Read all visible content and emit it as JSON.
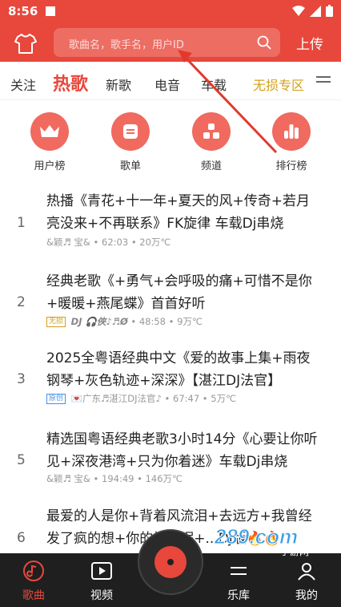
{
  "status_bar": {
    "time": "8:56"
  },
  "header": {
    "search_placeholder": "歌曲名，歌手名，用户ID",
    "upload_label": "上传"
  },
  "tabs": [
    {
      "label": "关注"
    },
    {
      "label": "热歌"
    },
    {
      "label": "新歌"
    },
    {
      "label": "电音"
    },
    {
      "label": "车载"
    },
    {
      "label": "无损专区"
    }
  ],
  "categories": [
    {
      "label": "用户榜",
      "icon": "crown-icon"
    },
    {
      "label": "歌单",
      "icon": "playlist-icon"
    },
    {
      "label": "频道",
      "icon": "channel-icon"
    },
    {
      "label": "排行榜",
      "icon": "ranking-icon"
    }
  ],
  "songs": [
    {
      "rank": "1",
      "title": "热播《青花+十一年+夏天的风+传奇+若月亮没来+不再联系》FK旋律 车载Dj串烧",
      "uploader": "&颖♬ 宝&",
      "duration": "62:03",
      "plays": "20万℃",
      "tag": ""
    },
    {
      "rank": "2",
      "title": "经典老歌《+勇气+会呼吸的痛+可惜不是你+暖暖+燕尾蝶》首首好听",
      "uploader": "DJ 🎧俠♪♬Ø",
      "duration": "48:58",
      "plays": "9万℃",
      "tag": "无损"
    },
    {
      "rank": "3",
      "title": "2025全粤语经典中文《爱的故事上集+雨夜钢琴+灰色轨迹+深深》【湛江DJ法官】",
      "uploader": "💌广东♬湛江DJ法官♪",
      "duration": "67:47",
      "plays": "5万℃",
      "tag": "原创"
    },
    {
      "rank": "5",
      "title": "精选国粤语经典老歌3小时14分《心要让你听见+深夜港湾+只为你着迷》车载Dj串烧",
      "uploader": "&颖♬ 宝&",
      "duration": "194:49",
      "plays": "146万℃",
      "tag": ""
    },
    {
      "rank": "6",
      "title": "最爱的人是你+背着风流泪+去远方+我曾经发了疯的想+你的棱角呢+...DJ版🔥🔥",
      "uploader": "",
      "duration": "",
      "plays": "",
      "tag": ""
    }
  ],
  "bottom_nav": [
    {
      "label": "歌曲"
    },
    {
      "label": "视频"
    },
    {
      "label": "乐库"
    },
    {
      "label": "我的"
    }
  ],
  "watermark": {
    "text": "289.com",
    "sub": "手游网"
  },
  "colors": {
    "brand_red": "#e8473b",
    "gold": "#d4a017",
    "nav_bg": "#1f1f1f"
  }
}
